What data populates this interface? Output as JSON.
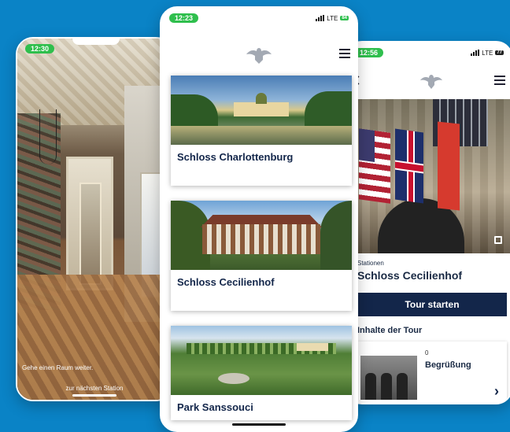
{
  "left_phone": {
    "time": "12:30",
    "instruction": "Gehe einen Raum weiter.",
    "next_label": "zur nächsten Station"
  },
  "center_phone": {
    "time": "12:23",
    "network": "LTE",
    "battery": "84",
    "cards": [
      {
        "name": "Schloss Charlottenburg"
      },
      {
        "name": "Schloss Cecilienhof"
      },
      {
        "name": "Park Sanssouci"
      }
    ]
  },
  "right_phone": {
    "time": "12:56",
    "network": "LTE",
    "battery": "77",
    "stations_label": "Stationen",
    "tour_title": "Schloss Cecilienhof",
    "start_button": "Tour starten",
    "contents_header": "Inhalte der Tour",
    "stations": [
      {
        "number": "0",
        "name": "Begrüßung"
      }
    ]
  },
  "colors": {
    "background": "#0a83c6",
    "navy": "#13264a",
    "status_green": "#2fbf4d"
  },
  "icons": [
    "eagle-logo-icon",
    "menu-icon",
    "expand-icon",
    "chevron-right-icon",
    "back-arrow-icon"
  ]
}
